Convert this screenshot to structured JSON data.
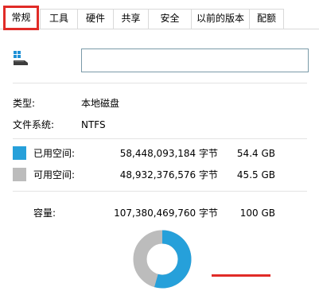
{
  "tabs": {
    "general": "常规",
    "tools": "工具",
    "hardware": "硬件",
    "sharing": "共享",
    "security": "安全",
    "previous_versions": "以前的版本",
    "quota": "配额"
  },
  "drive": {
    "icon": "windows-drive-icon",
    "name_value": "",
    "type_label": "类型:",
    "type_value": "本地磁盘",
    "fs_label": "文件系统:",
    "fs_value": "NTFS"
  },
  "usage": {
    "used_label": "已用空间:",
    "used_bytes": "58,448,093,184 字节",
    "used_size": "54.4 GB",
    "free_label": "可用空间:",
    "free_bytes": "48,932,376,576 字节",
    "free_size": "45.5 GB",
    "capacity_label": "容量:",
    "capacity_bytes": "107,380,469,760 字节",
    "capacity_size": "100 GB",
    "used_fraction": 0.544
  },
  "colors": {
    "used": "#26a0da",
    "free": "#bcbcbc",
    "highlight": "#e02b27"
  }
}
